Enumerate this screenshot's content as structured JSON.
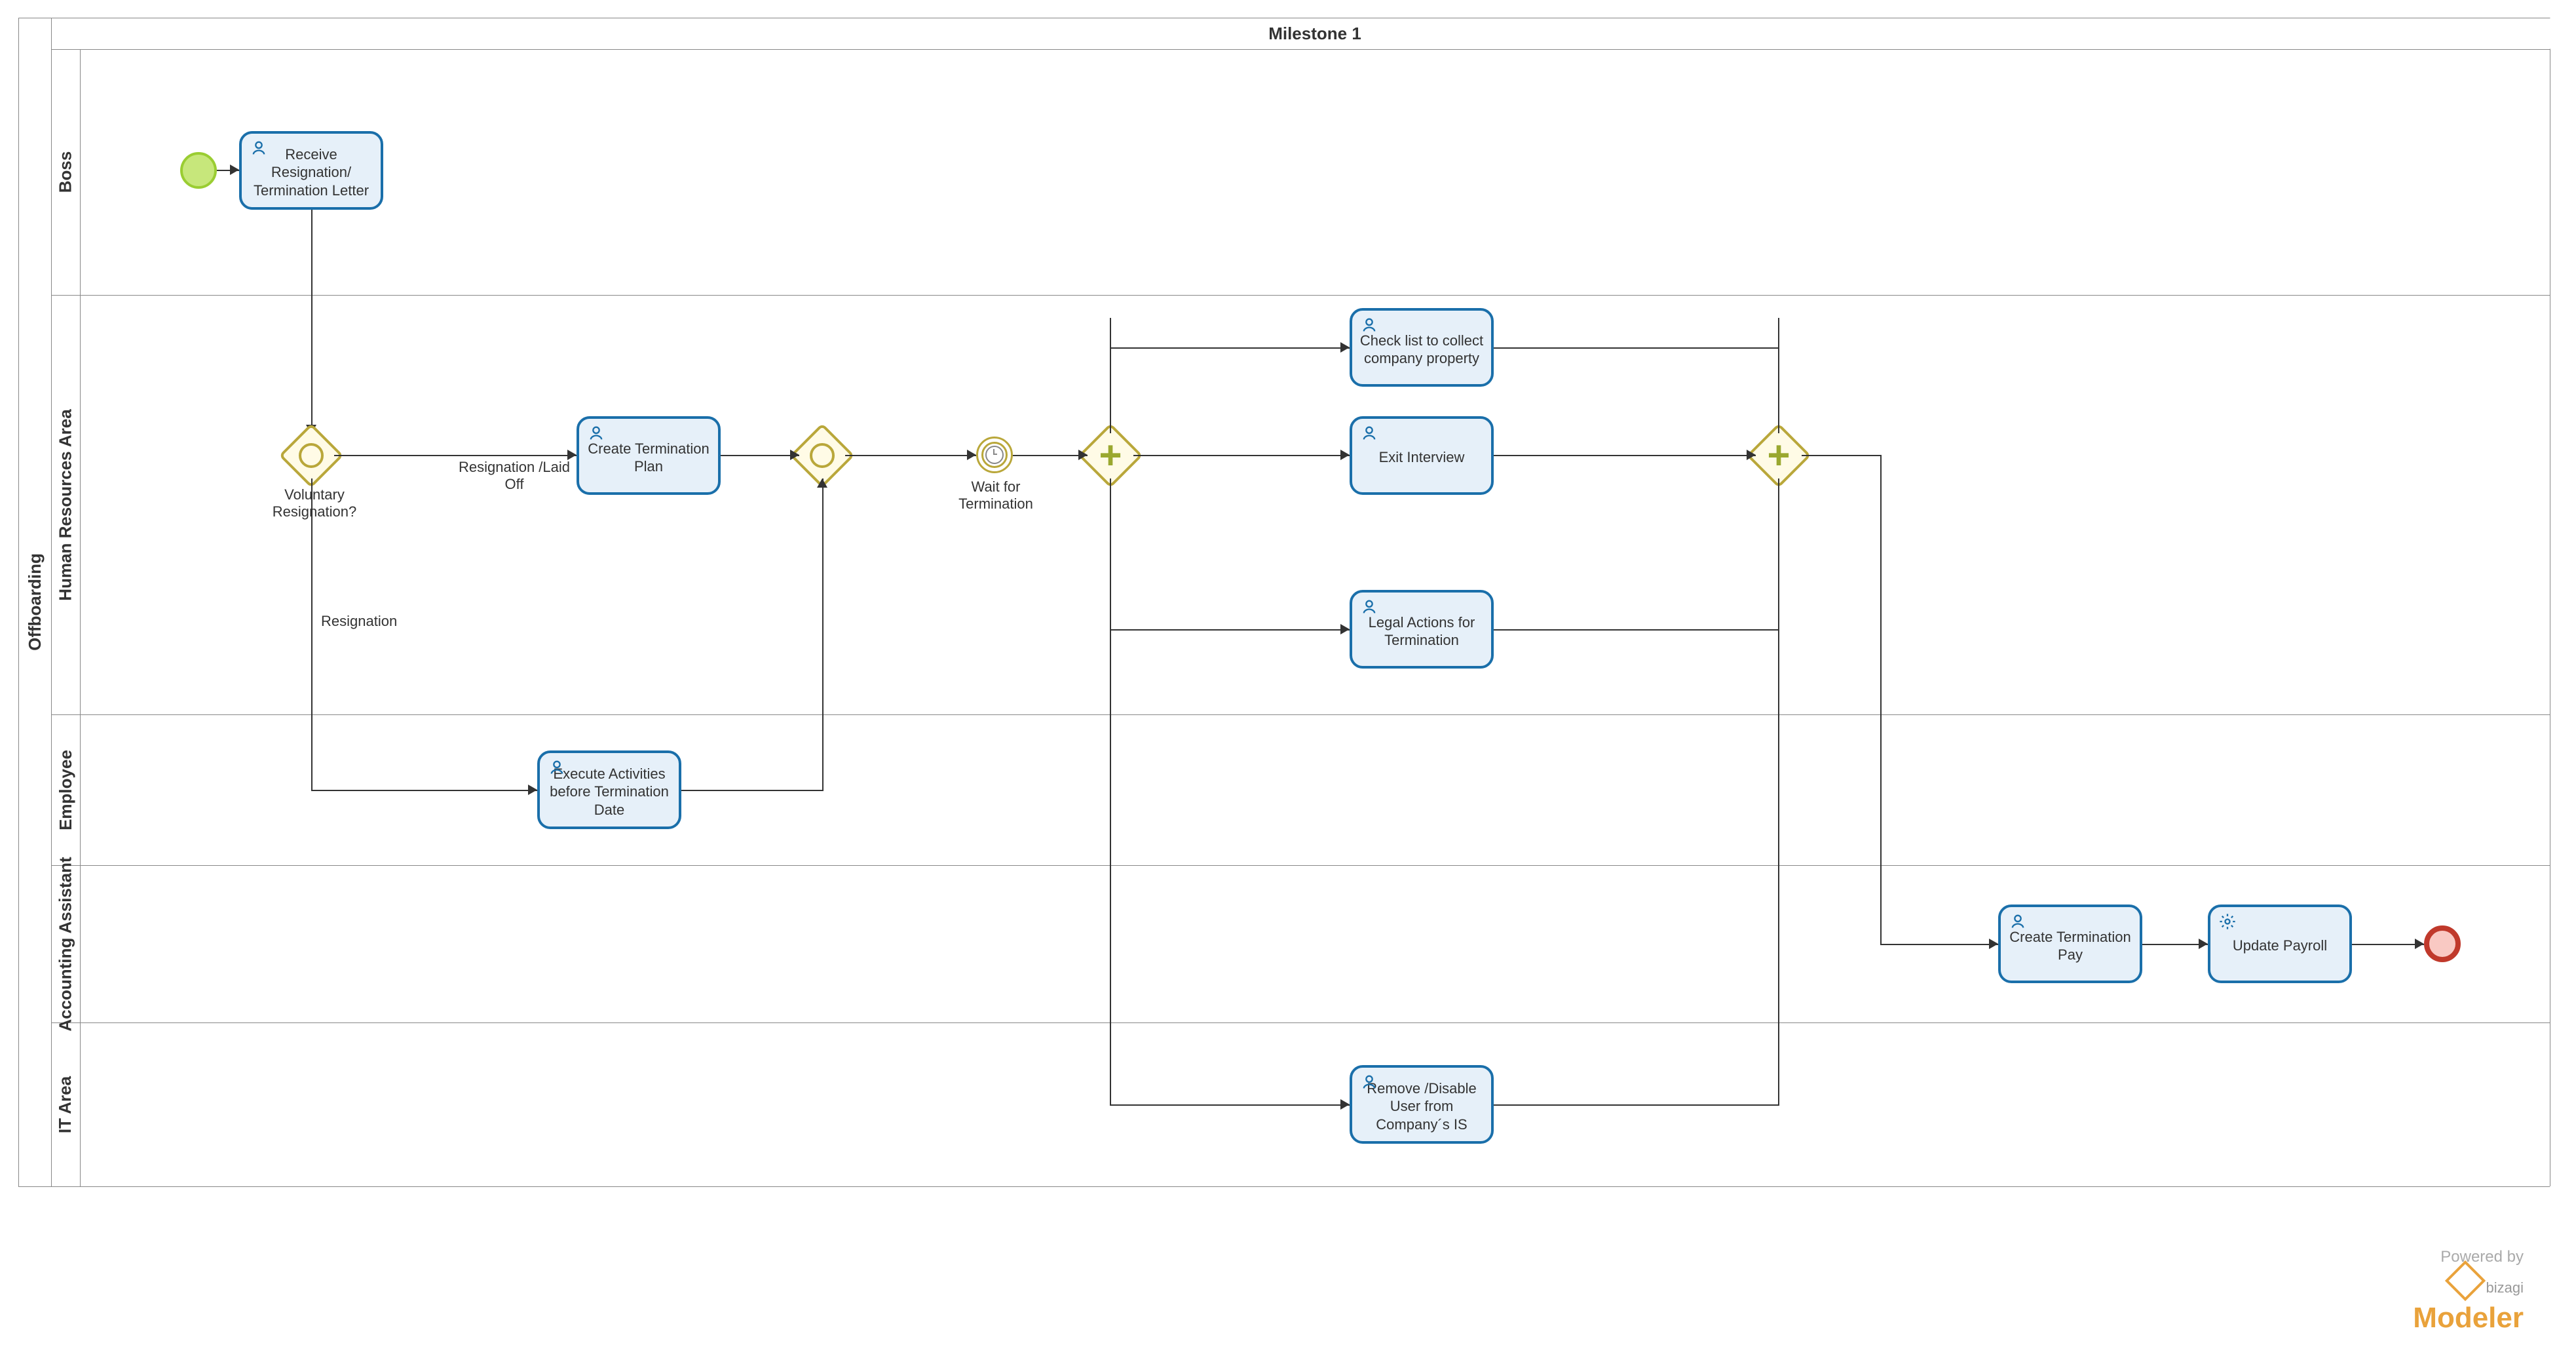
{
  "pool": {
    "name": "Offboarding"
  },
  "milestone": {
    "title": "Milestone 1"
  },
  "lanes": {
    "boss": "Boss",
    "hr": "Human Resources Area",
    "employee": "Employee",
    "accounting": "Accounting Assistant",
    "it": "IT Area"
  },
  "tasks": {
    "receive": "Receive Resignation/ Termination Letter",
    "createPlan": "Create Termination Plan",
    "checklist": "Check list to collect company property",
    "exitInterview": "Exit Interview",
    "legalActions": "Legal Actions for Termination",
    "executeActivities": "Execute Activities before Termination Date",
    "removeUser": "Remove /Disable User from Company´s IS",
    "createPay": "Create Termination Pay",
    "updatePayroll": "Update Payroll"
  },
  "gateways": {
    "voluntary": "Voluntary Resignation?",
    "waitTimer": "Wait for Termination"
  },
  "flows": {
    "resignationLaidOff": "Resignation /Laid Off",
    "resignation": "Resignation"
  },
  "footer": {
    "powered": "Powered by",
    "brand_prefix": "bizagi",
    "brand": "Modeler"
  }
}
